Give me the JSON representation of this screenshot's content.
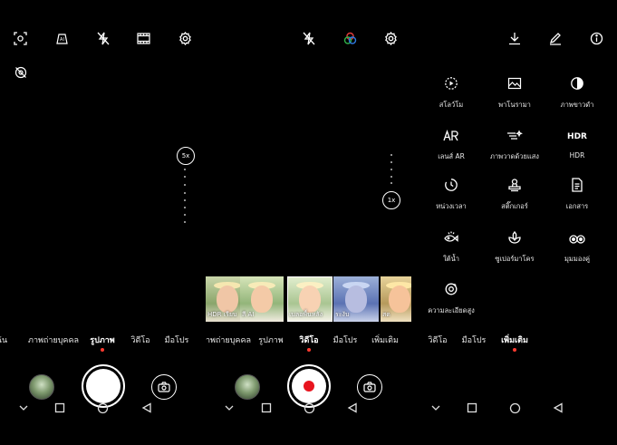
{
  "photo_screen": {
    "top_icons": [
      "frame-icon",
      "ai-icon",
      "flash-off-icon",
      "film-icon",
      "settings-icon"
    ],
    "side_icon": "eye-off-icon",
    "zoom_label": "5x",
    "modes": [
      {
        "label": "ฉัน",
        "active": false
      },
      {
        "label": "ภาพถ่ายบุคคล",
        "active": false
      },
      {
        "label": "รูปภาพ",
        "active": true
      },
      {
        "label": "วิดีโอ",
        "active": false
      },
      {
        "label": "มือโปร",
        "active": false
      }
    ]
  },
  "video_screen": {
    "top_icons": [
      "flash-off-icon",
      "color-filter-icon",
      "settings-icon"
    ],
    "zoom_label": "1x",
    "filters": [
      {
        "label": "HDR เรียบ",
        "tone": "warm"
      },
      {
        "label": "สี AI",
        "tone": "natural"
      },
      {
        "label": "เบลอพื้นหลัง",
        "tone": "bright",
        "selected": true
      },
      {
        "label": "ระงับ",
        "tone": "blue"
      },
      {
        "label": "สด",
        "tone": "vivid"
      }
    ],
    "modes": [
      {
        "label": "ภาพถ่ายบุคคล",
        "active": false
      },
      {
        "label": "รูปภาพ",
        "active": false
      },
      {
        "label": "วิดีโอ",
        "active": true
      },
      {
        "label": "มือโปร",
        "active": false
      },
      {
        "label": "เพิ่มเติม",
        "active": false
      }
    ]
  },
  "more_screen": {
    "top_icons": [
      "download-icon",
      "edit-icon",
      "info-icon"
    ],
    "items": [
      {
        "label": "สโลว์โม",
        "icon": "slowmo-icon"
      },
      {
        "label": "พาโนรามา",
        "icon": "panorama-icon"
      },
      {
        "label": "ภาพขาวดำ",
        "icon": "monochrome-icon"
      },
      {
        "label": "เลนส์ AR",
        "icon": "ar-icon"
      },
      {
        "label": "ภาพวาดด้วยแสง",
        "icon": "light-painting-icon"
      },
      {
        "label": "HDR",
        "icon": "hdr-icon",
        "icon_text": "HDR"
      },
      {
        "label": "หน่วงเวลา",
        "icon": "timelapse-icon"
      },
      {
        "label": "สติ๊กเกอร์",
        "icon": "sticker-icon"
      },
      {
        "label": "เอกสาร",
        "icon": "document-icon"
      },
      {
        "label": "ใต้น้ำ",
        "icon": "underwater-icon"
      },
      {
        "label": "ซูเปอร์มาโคร",
        "icon": "super-macro-icon"
      },
      {
        "label": "มุมมองคู่",
        "icon": "dual-view-icon"
      },
      {
        "label": "ความละเอียดสูง",
        "icon": "high-resolution-icon"
      }
    ],
    "modes": [
      {
        "label": "วิดีโอ",
        "active": false
      },
      {
        "label": "มือโปร",
        "active": false
      },
      {
        "label": "เพิ่มเติม",
        "active": true
      }
    ]
  },
  "nav_icons": [
    "back-chevron-icon",
    "recents-square-icon",
    "home-circle-icon",
    "back-triangle-icon"
  ],
  "colors": {
    "record": "#e8141e",
    "mode_dot": "#ff3b30",
    "background": "#000000"
  }
}
